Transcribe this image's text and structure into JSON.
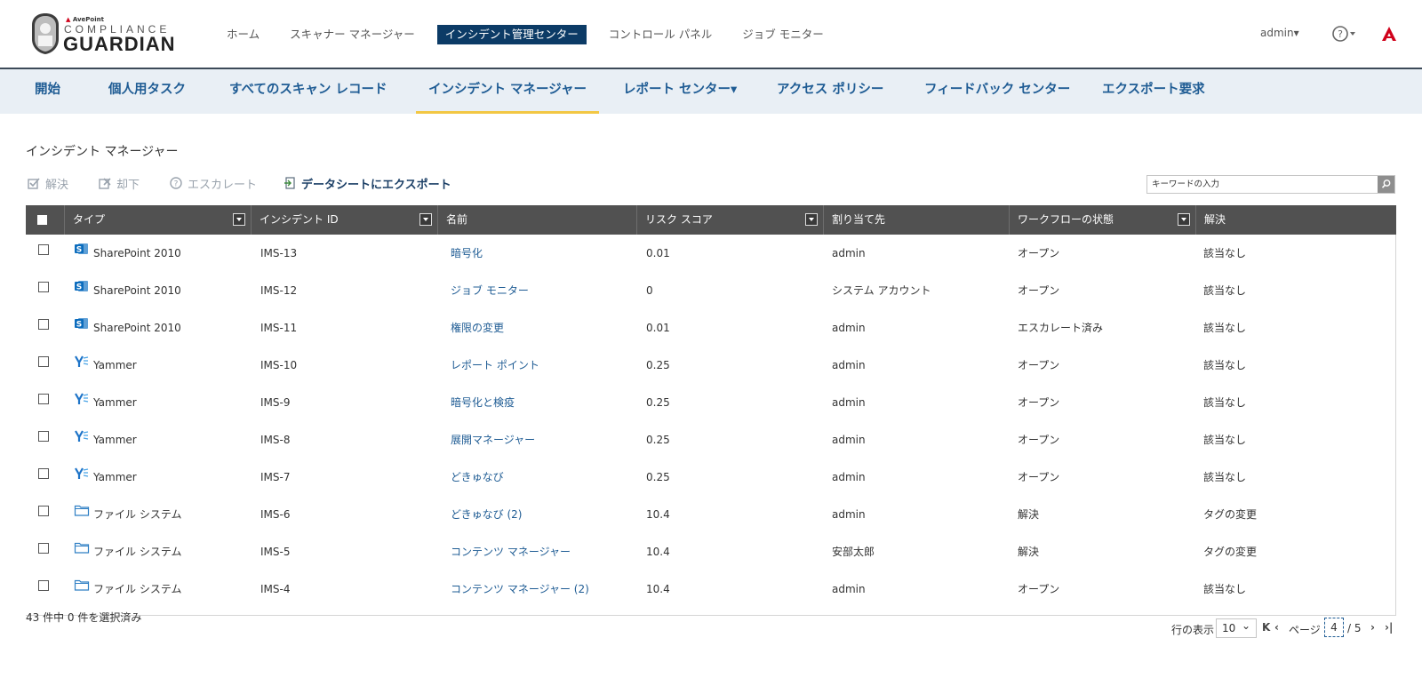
{
  "brand": {
    "small": "AvePoint",
    "compliance": "COMPLIANCE",
    "guardian": "GUARDIAN",
    "accent": "#d0021b"
  },
  "main_nav": [
    {
      "label": "ホーム"
    },
    {
      "label": "スキャナー マネージャー"
    },
    {
      "label": "インシデント管理センター",
      "active": true
    },
    {
      "label": "コントロール パネル"
    },
    {
      "label": "ジョブ モニター"
    }
  ],
  "user": {
    "name": "admin▾"
  },
  "help": {
    "icon": "help-icon"
  },
  "sub_nav": [
    {
      "label": "開始"
    },
    {
      "label": "個人用タスク"
    },
    {
      "label": "すべてのスキャン レコード"
    },
    {
      "label": "インシデント マネージャー",
      "active": true
    },
    {
      "label": "レポート センター▾"
    },
    {
      "label": "アクセス ポリシー"
    },
    {
      "label": "フィードバック センター"
    },
    {
      "label": "エクスポート要求"
    }
  ],
  "page": {
    "title": "インシデント マネージャー"
  },
  "toolbar": {
    "resolve": "解決",
    "reject": "却下",
    "escalate": "エスカレート",
    "export": "データシートにエクスポート"
  },
  "search": {
    "placeholder": "キーワードの入力"
  },
  "table": {
    "columns": [
      "タイプ",
      "インシデント ID",
      "名前",
      "リスク スコア",
      "割り当て先",
      "ワークフローの状態",
      "解決"
    ],
    "rows": [
      {
        "type": "SharePoint 2010",
        "icon": "sharepoint-icon",
        "id": "IMS-13",
        "name": "暗号化",
        "risk": "0.01",
        "assignee": "admin",
        "state": "オープン",
        "resolution": "該当なし"
      },
      {
        "type": "SharePoint 2010",
        "icon": "sharepoint-icon",
        "id": "IMS-12",
        "name": "ジョブ モニター",
        "risk": "0",
        "assignee": "システム アカウント",
        "state": "オープン",
        "resolution": "該当なし"
      },
      {
        "type": "SharePoint 2010",
        "icon": "sharepoint-icon",
        "id": "IMS-11",
        "name": "権限の変更",
        "risk": "0.01",
        "assignee": "admin",
        "state": "エスカレート済み",
        "resolution": "該当なし"
      },
      {
        "type": "Yammer",
        "icon": "yammer-icon",
        "id": "IMS-10",
        "name": "レポート ポイント",
        "risk": "0.25",
        "assignee": "admin",
        "state": "オープン",
        "resolution": "該当なし"
      },
      {
        "type": "Yammer",
        "icon": "yammer-icon",
        "id": "IMS-9",
        "name": "暗号化と検疫",
        "risk": "0.25",
        "assignee": "admin",
        "state": "オープン",
        "resolution": "該当なし"
      },
      {
        "type": "Yammer",
        "icon": "yammer-icon",
        "id": "IMS-8",
        "name": "展開マネージャー",
        "risk": "0.25",
        "assignee": "admin",
        "state": "オープン",
        "resolution": "該当なし"
      },
      {
        "type": "Yammer",
        "icon": "yammer-icon",
        "id": "IMS-7",
        "name": "どきゅなび",
        "risk": "0.25",
        "assignee": "admin",
        "state": "オープン",
        "resolution": "該当なし"
      },
      {
        "type": "ファイル システム",
        "icon": "folder-icon",
        "id": "IMS-6",
        "name": "どきゅなび (2)",
        "risk": "10.4",
        "assignee": "admin",
        "state": "解決",
        "resolution": "タグの変更"
      },
      {
        "type": "ファイル システム",
        "icon": "folder-icon",
        "id": "IMS-5",
        "name": "コンテンツ マネージャー",
        "risk": "10.4",
        "assignee": "安部太郎",
        "state": "解決",
        "resolution": "タグの変更"
      },
      {
        "type": "ファイル システム",
        "icon": "folder-icon",
        "id": "IMS-4",
        "name": "コンテンツ マネージャー (2)",
        "risk": "10.4",
        "assignee": "admin",
        "state": "オープン",
        "resolution": "該当なし"
      }
    ]
  },
  "footer": {
    "selected": "43 件中 0 件を選択済み",
    "rows_label": "行の表示",
    "page_size": "10",
    "page_label": "ページ",
    "current_page": "4",
    "total_pages": "/ 5"
  }
}
